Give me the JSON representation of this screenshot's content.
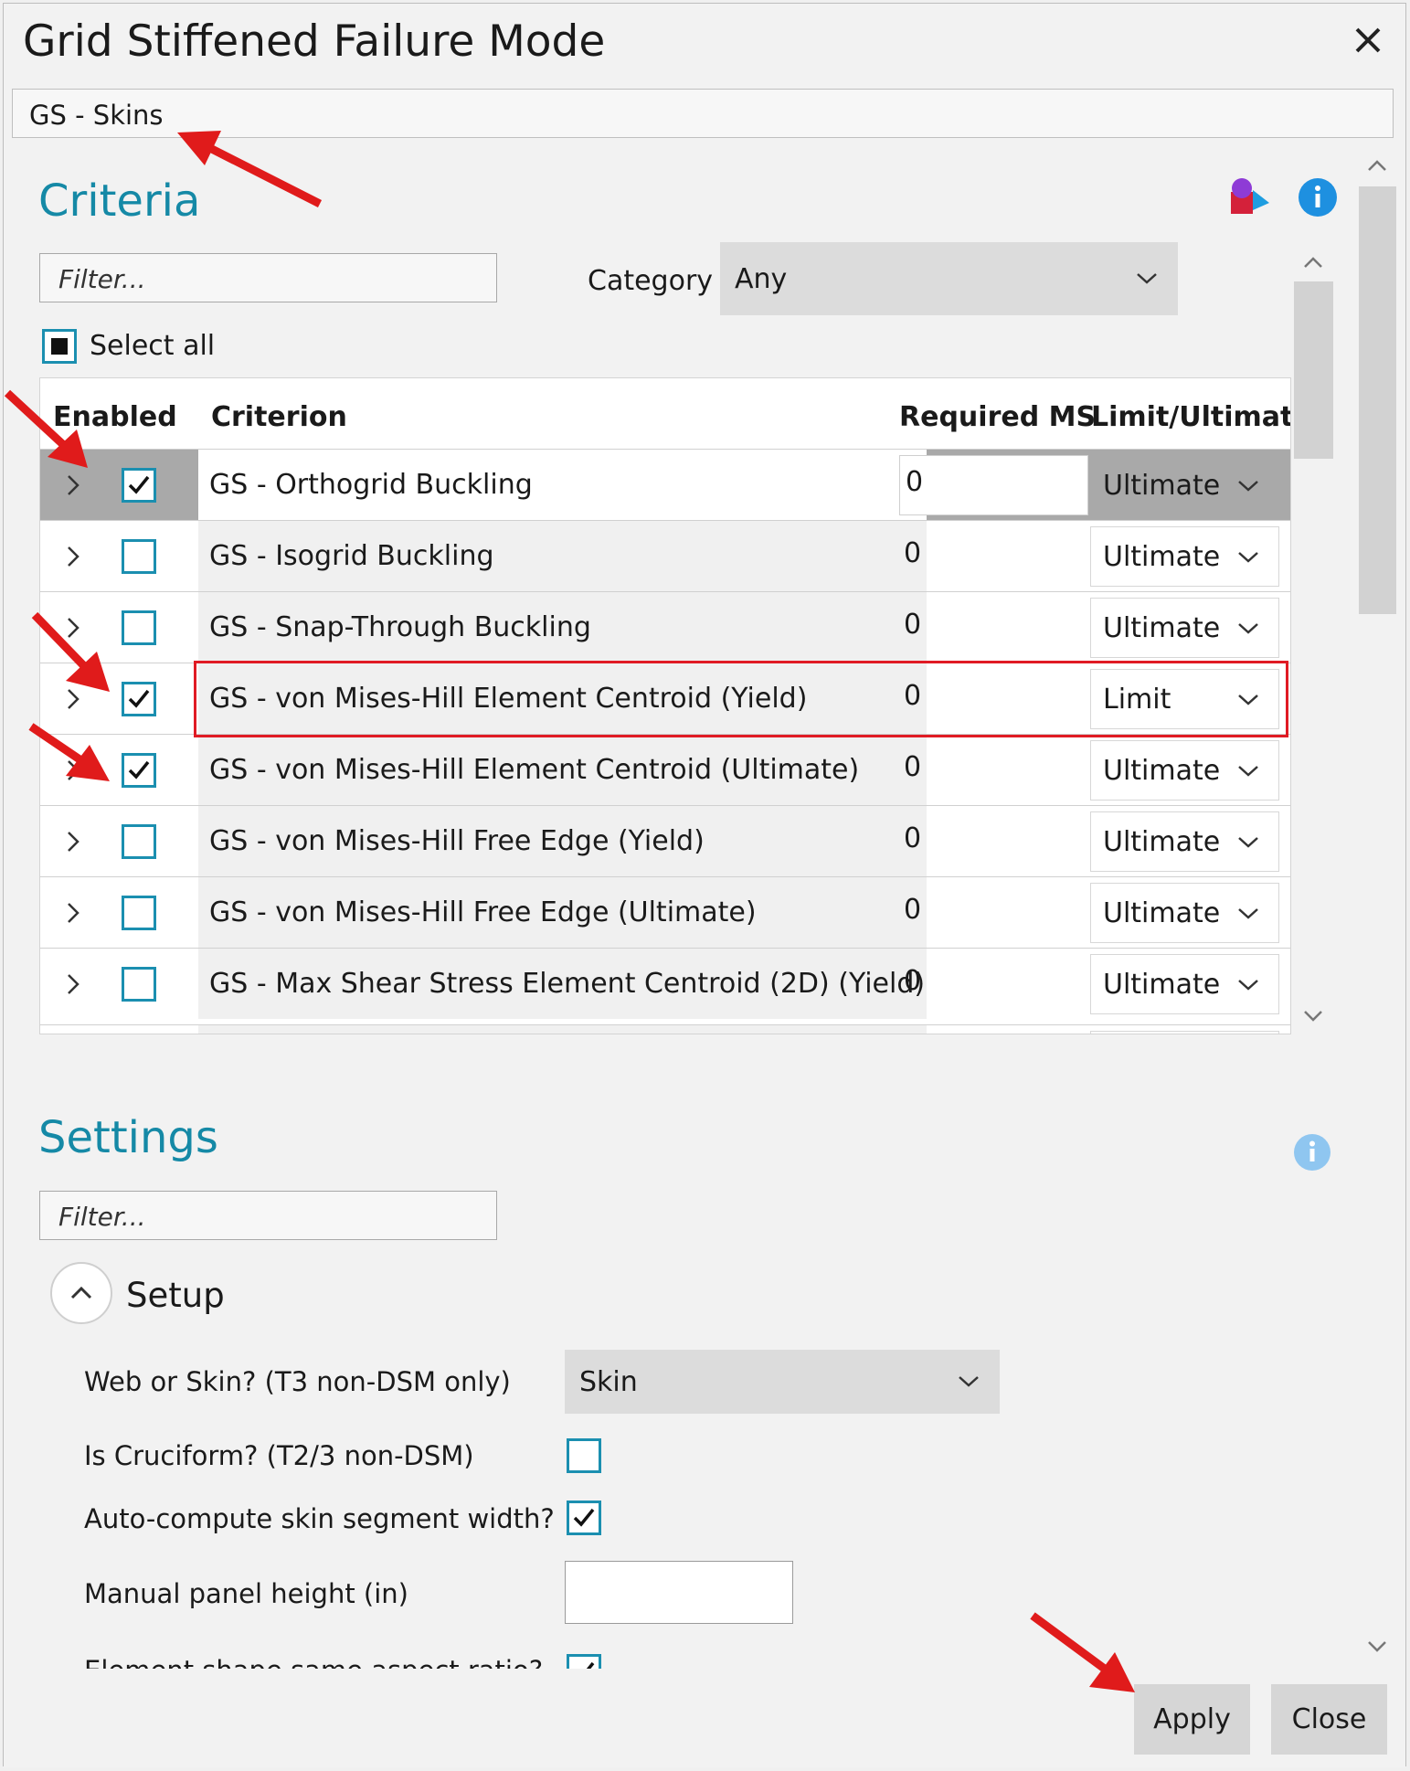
{
  "window": {
    "title": "Grid Stiffened Failure Mode",
    "name_value": "GS - Skins"
  },
  "criteria": {
    "heading": "Criteria",
    "filter_placeholder": "Filter...",
    "category_label": "Category",
    "category_value": "Any",
    "select_all_label": "Select all",
    "columns": {
      "enabled": "Enabled",
      "criterion": "Criterion",
      "required_ms": "Required MS",
      "limit_ultimate": "Limit/Ultimate"
    },
    "rows": [
      {
        "checked": true,
        "name": "GS - Orthogrid Buckling",
        "ms": "0",
        "lu": "Ultimate"
      },
      {
        "checked": false,
        "name": "GS - Isogrid Buckling",
        "ms": "0",
        "lu": "Ultimate"
      },
      {
        "checked": false,
        "name": "GS - Snap-Through Buckling",
        "ms": "0",
        "lu": "Ultimate"
      },
      {
        "checked": true,
        "name": "GS - von Mises-Hill Element Centroid (Yield)",
        "ms": "0",
        "lu": "Limit"
      },
      {
        "checked": true,
        "name": "GS - von Mises-Hill Element Centroid (Ultimate)",
        "ms": "0",
        "lu": "Ultimate"
      },
      {
        "checked": false,
        "name": "GS - von Mises-Hill Free Edge (Yield)",
        "ms": "0",
        "lu": "Ultimate"
      },
      {
        "checked": false,
        "name": "GS - von Mises-Hill Free Edge (Ultimate)",
        "ms": "0",
        "lu": "Ultimate"
      },
      {
        "checked": false,
        "name": "GS - Max Shear Stress Element Centroid (2D) (Yield)",
        "ms": "0",
        "lu": "Ultimate"
      }
    ]
  },
  "settings": {
    "heading": "Settings",
    "filter_placeholder": "Filter...",
    "setup_label": "Setup",
    "web_or_skin_label": "Web or Skin? (T3 non-DSM only)",
    "web_or_skin_value": "Skin",
    "cruciform_label": "Is Cruciform? (T2/3 non-DSM)",
    "cruciform_checked": false,
    "auto_compute_label": "Auto-compute skin segment width?",
    "auto_compute_checked": true,
    "panel_height_label": "Manual panel height (in)",
    "panel_height_value": "",
    "aspect_label": "Element shape same aspect ratio?",
    "aspect_checked": true
  },
  "buttons": {
    "apply": "Apply",
    "close": "Close"
  },
  "colors": {
    "accent": "#1589a6",
    "checkbox": "#1b8fb0",
    "info": "#1e90e0",
    "highlight": "#e01b24",
    "arrow": "#e01b1b"
  }
}
